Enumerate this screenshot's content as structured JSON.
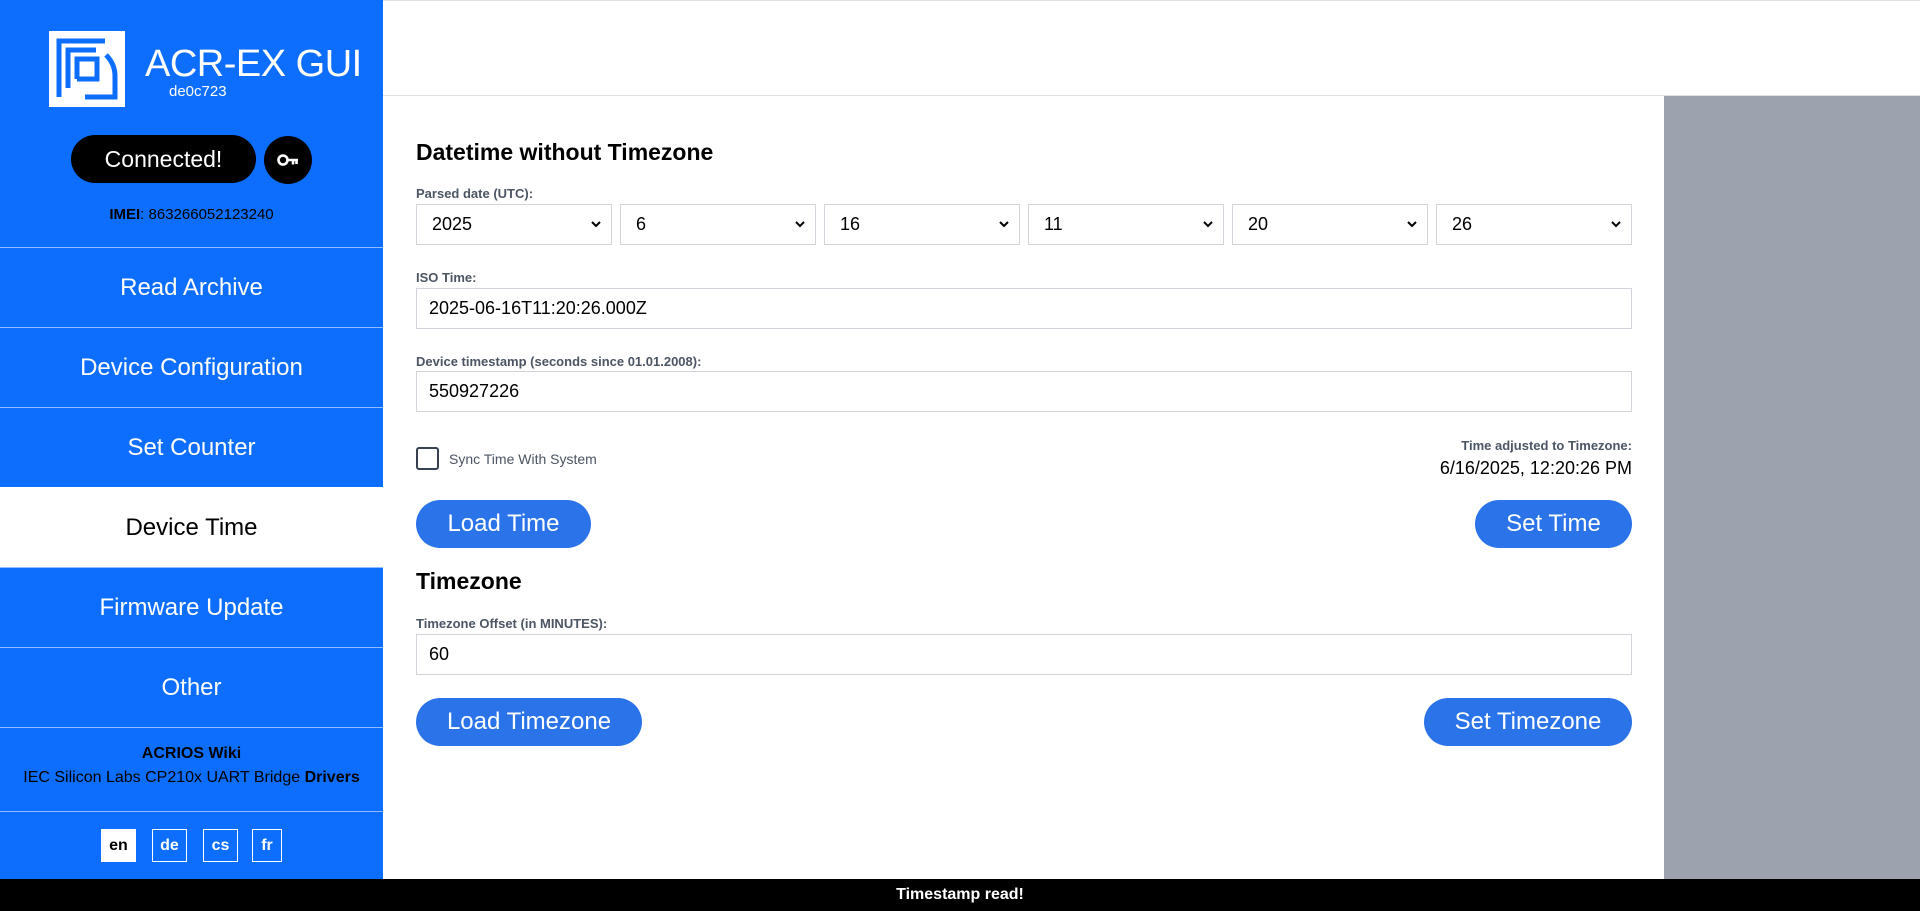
{
  "sidebar": {
    "app_title": "ACR-EX GUI",
    "version": "de0c723",
    "connection_label": "Connected!",
    "imei_label": "IMEI",
    "imei_value": "863266052123240",
    "nav": [
      {
        "label": "Read Archive"
      },
      {
        "label": "Device Configuration"
      },
      {
        "label": "Set Counter"
      },
      {
        "label": "Device Time",
        "active": true
      },
      {
        "label": "Firmware Update"
      },
      {
        "label": "Other"
      }
    ],
    "wiki_link": "ACRIOS Wiki",
    "drivers_prefix": "IEC Silicon Labs CP210x UART Bridge",
    "drivers_link": "Drivers",
    "languages": [
      "en",
      "de",
      "cs",
      "fr"
    ],
    "active_language": "en"
  },
  "colors": {
    "sidebar_blue": "#0d6efd",
    "button_blue": "#2a73e8",
    "panel_gray": "#9ca3af",
    "footer_black": "#000000"
  },
  "datetime": {
    "heading": "Datetime without Timezone",
    "parsed_label": "Parsed date (UTC):",
    "year": "2025",
    "month": "6",
    "day": "16",
    "hour": "11",
    "minute": "20",
    "second": "26",
    "iso_label": "ISO Time:",
    "iso_value": "2025-06-16T11:20:26.000Z",
    "timestamp_label": "Device timestamp (seconds since 01.01.2008):",
    "timestamp_value": "550927226",
    "sync_label": "Sync Time With System",
    "sync_checked": false,
    "adjusted_label": "Time adjusted to Timezone:",
    "adjusted_value": "6/16/2025, 12:20:26 PM",
    "load_button": "Load Time",
    "set_button": "Set Time"
  },
  "timezone": {
    "heading": "Timezone",
    "offset_label": "Timezone Offset (in MINUTES):",
    "offset_value": "60",
    "load_button": "Load Timezone",
    "set_button": "Set Timezone"
  },
  "footer": {
    "message": "Timestamp read!"
  }
}
